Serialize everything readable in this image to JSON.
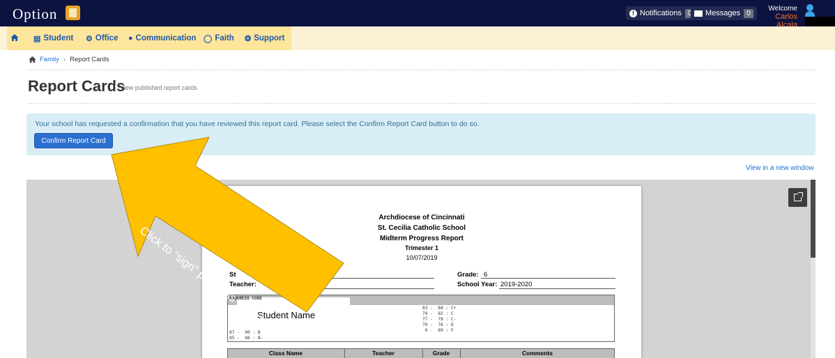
{
  "topbar": {
    "brand": "Option",
    "notifications": {
      "label": "Notifications",
      "count": "0"
    },
    "messages": {
      "label": "Messages",
      "count": "0"
    },
    "welcome": "Welcome",
    "user_name": "Carlos Alcala"
  },
  "menu": {
    "items": [
      {
        "label": "Student",
        "icon": "book-icon"
      },
      {
        "label": "Office",
        "icon": "cogs-icon"
      },
      {
        "label": "Communication",
        "icon": "chat-icon"
      },
      {
        "label": "Faith",
        "icon": "compass-icon"
      },
      {
        "label": "Support",
        "icon": "lifebuoy-icon"
      }
    ]
  },
  "breadcrumb": {
    "parent": "Family",
    "current": "Report Cards"
  },
  "page": {
    "title": "Report Cards",
    "subtitle": "View published report cards"
  },
  "alert": {
    "text": "Your school has requested a confirmation that you have reviewed this report card. Please select the Confirm Report Card button to do so.",
    "button": "Confirm Report Card"
  },
  "viewer": {
    "new_window_link": "View in a new window"
  },
  "report": {
    "header": [
      "Archdiocese of Cincinnati",
      "St. Cecilia Catholic School",
      "Midterm Progress Report",
      "Trimester 1",
      "10/07/2019"
    ],
    "student_label": "St",
    "teacher_label": "Teacher:",
    "grade_label": "Grade:",
    "grade_value": "6",
    "school_year_label": "School Year:",
    "school_year_value": "2019-2020",
    "progress_code_label": "PROGRESS CODE",
    "scale_left": [
      "87 -  90 : B",
      "85 -  86 : B-"
    ],
    "scale_right": [
      "83 -  84 : C+",
      "79 -  82 : C",
      "77 -  78 : C-",
      "70 -  76 : D",
      " 0 -  69 : F"
    ],
    "student_name_overlay": "Student Name",
    "table_headers": [
      "Class Name",
      "Teacher",
      "Grade",
      "Comments"
    ]
  },
  "annotation": {
    "text": "Click to “sign” progress report",
    "color": "#ffc000"
  },
  "colors": {
    "topbar": "#0c1340",
    "menubar": "#fbf2d6",
    "link": "#1f6fcf",
    "button": "#2b6fd0",
    "alert_bg": "#d9edf7",
    "user_name": "#f0722e"
  }
}
